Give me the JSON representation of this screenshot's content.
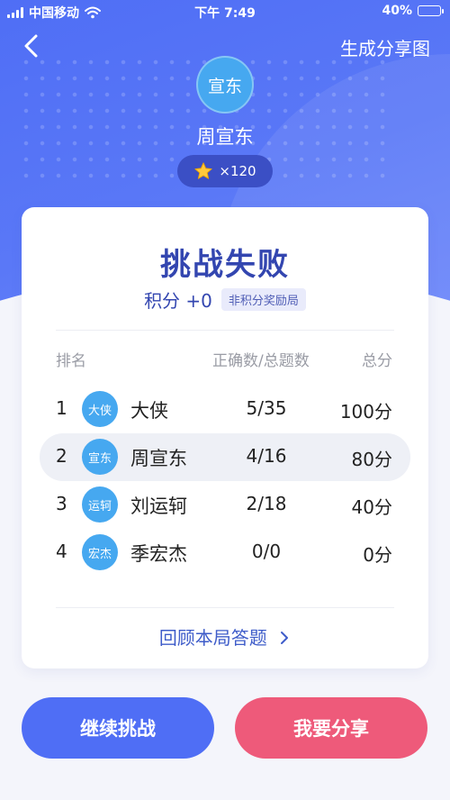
{
  "status_bar": {
    "carrier": "中国移动",
    "time": "下午 7:49",
    "battery": "40%",
    "battery_level": 0.4
  },
  "header": {
    "share_image_label": "生成分享图",
    "avatar_text": "宣东",
    "username": "周宣东",
    "stars": "×120"
  },
  "result": {
    "title": "挑战失败",
    "score_text": "积分 +0",
    "score_badge": "非积分奖励局"
  },
  "table": {
    "headers": {
      "rank": "排名",
      "correct": "正确数/总题数",
      "total": "总分"
    },
    "rows": [
      {
        "rank": "1",
        "avatar": "大侠",
        "name": "大侠",
        "correct": "5/35",
        "total": "100分"
      },
      {
        "rank": "2",
        "avatar": "宣东",
        "name": "周宣东",
        "correct": "4/16",
        "total": "80分"
      },
      {
        "rank": "3",
        "avatar": "运轲",
        "name": "刘运轲",
        "correct": "2/18",
        "total": "40分"
      },
      {
        "rank": "4",
        "avatar": "宏杰",
        "name": "季宏杰",
        "correct": "0/0",
        "total": "0分"
      }
    ]
  },
  "review_label": "回顾本局答题",
  "buttons": {
    "continue": "继续挑战",
    "share": "我要分享"
  },
  "colors": {
    "primary": "#4f6ef5",
    "title": "#3346b0",
    "share": "#ee5a7a",
    "avatar": "#46a8f0"
  }
}
